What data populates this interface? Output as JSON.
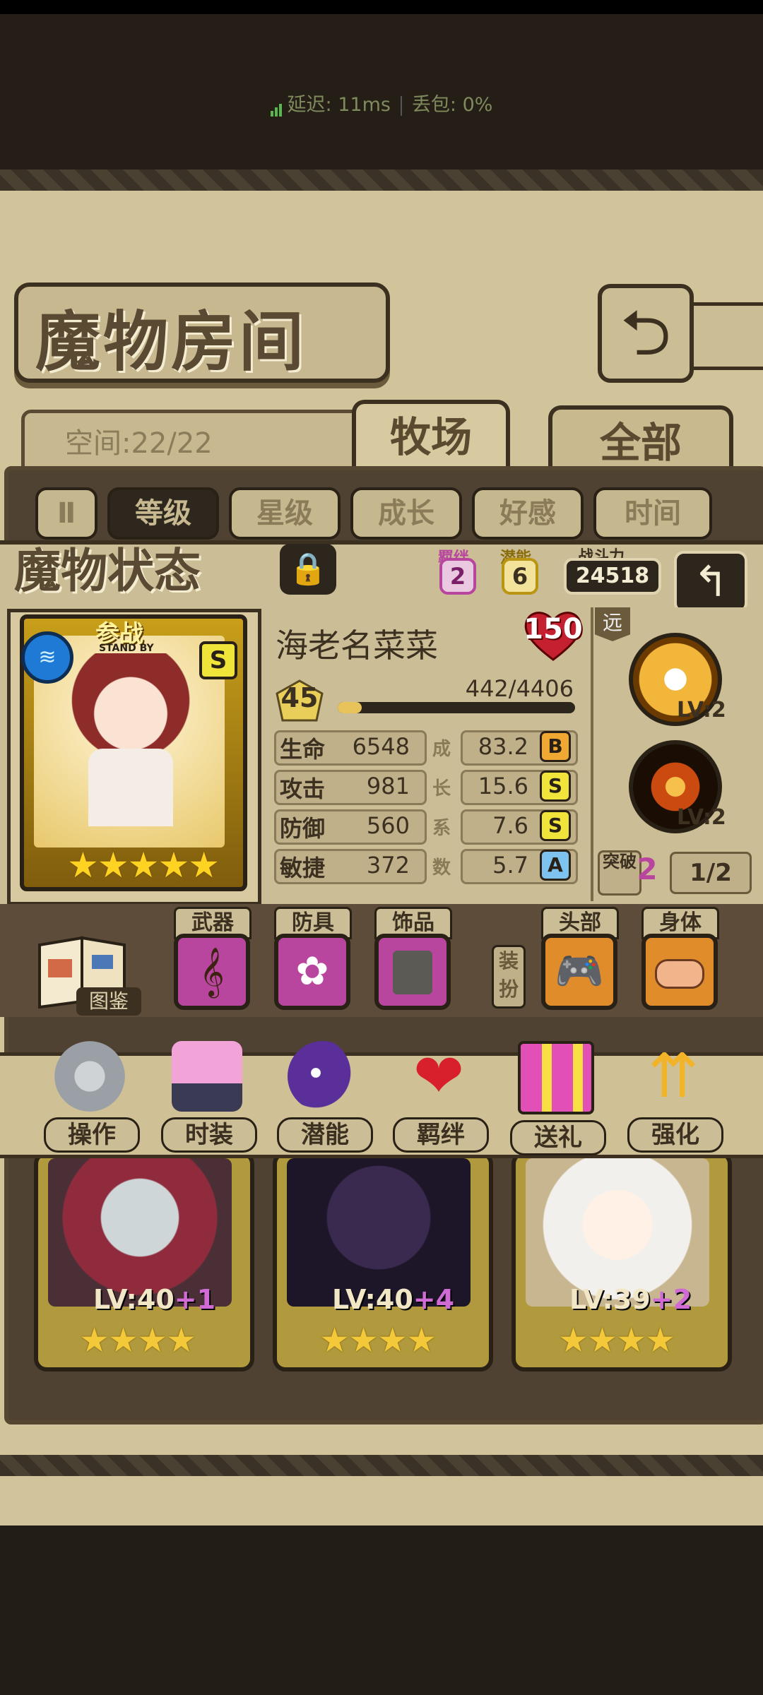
{
  "status_bar": {
    "latency_label": "延迟: 11ms",
    "loss_label": "丢包: 0%"
  },
  "header": {
    "title": "魔物房间",
    "back_icon": "return-arrow-icon"
  },
  "space": {
    "label": "空间:22/22"
  },
  "tabs": [
    {
      "label": "牧场",
      "active": true
    },
    {
      "label": "全部",
      "active": false
    }
  ],
  "sort": {
    "toggle": "Ⅱ",
    "options": [
      "等级",
      "星级",
      "成长",
      "好感",
      "时间"
    ],
    "active": 0
  },
  "status": {
    "title": "魔物状态",
    "bond": {
      "label": "羁绊",
      "value": "2"
    },
    "potential": {
      "label": "潜能",
      "value": "6"
    },
    "power": {
      "label": "战斗力",
      "value": "24518"
    },
    "standby": {
      "label": "参战",
      "sub": "STAND BY"
    },
    "rank": "S",
    "stars": "★★★★★",
    "name": "海老名菜菜",
    "affection": "150",
    "level": "45",
    "xp_text": "442/4406",
    "xp_fraction": 0.1,
    "growth_label": [
      "成",
      "长",
      "系",
      "数"
    ],
    "stats": [
      {
        "label": "生命",
        "value": "6548",
        "growth": "83.2",
        "grade": "B",
        "grade_color": "#f0a833"
      },
      {
        "label": "攻击",
        "value": "981",
        "growth": "15.6",
        "grade": "S",
        "grade_color": "#f0e33a"
      },
      {
        "label": "防御",
        "value": "560",
        "growth": "7.6",
        "grade": "S",
        "grade_color": "#f0e33a"
      },
      {
        "label": "敏捷",
        "value": "372",
        "growth": "5.7",
        "grade": "A",
        "grade_color": "#7ec3f0"
      }
    ],
    "range_label": "远",
    "skills": [
      {
        "level": "LV:2"
      },
      {
        "level": "LV:2"
      }
    ],
    "breakthrough": {
      "label": "突破",
      "value": "2",
      "progress": "1/2"
    }
  },
  "equipment": {
    "codex_label": "图鉴",
    "slots": [
      {
        "label": "武器",
        "icon": "harp-icon"
      },
      {
        "label": "防具",
        "icon": "bow-cloth-icon"
      },
      {
        "label": "饰品",
        "icon": "stone-tablet-icon"
      }
    ],
    "dress_label": "装扮",
    "dress_slots": [
      {
        "label": "头部",
        "icon": "gamepad-icon"
      },
      {
        "label": "身体",
        "icon": "bread-icon"
      }
    ]
  },
  "actions": [
    {
      "label": "操作",
      "icon": "gear-icon"
    },
    {
      "label": "时装",
      "icon": "clothes-icon"
    },
    {
      "label": "潜能",
      "icon": "demon-icon"
    },
    {
      "label": "羁绊",
      "icon": "hearts-icon"
    },
    {
      "label": "送礼",
      "icon": "gift-icon"
    },
    {
      "label": "强化",
      "icon": "up-arrows-icon"
    }
  ],
  "monsters": [
    {
      "lv": "LV:40",
      "plus": "+1",
      "stars": "★★★★"
    },
    {
      "lv": "LV:40",
      "plus": "+4",
      "stars": "★★★★"
    },
    {
      "lv": "LV:39",
      "plus": "+2",
      "stars": "★★★★"
    }
  ]
}
